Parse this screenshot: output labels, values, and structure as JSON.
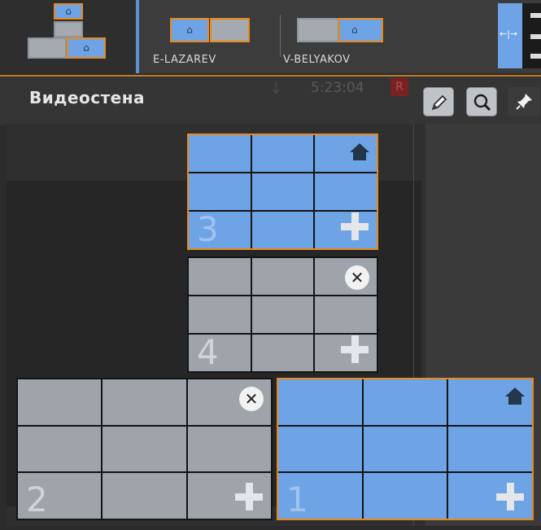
{
  "topbar": {
    "users": [
      {
        "name": "E-LAZAREV"
      },
      {
        "name": "V-BELYAKOV"
      }
    ],
    "arrows_glyph": "←|→",
    "mini_home_glyph": "⌂"
  },
  "header": {
    "title": "Видеостена",
    "ghost_time": "5:23:04",
    "ghost_r": "R",
    "ghost_arrow": "↓"
  },
  "toolbar": {
    "edit_icon": "pencil-icon",
    "search_icon": "search-icon",
    "pin_icon": "pin-icon"
  },
  "monitors": [
    {
      "number": "3",
      "color": "blue",
      "selected": true,
      "corner": "home"
    },
    {
      "number": "4",
      "color": "gray",
      "selected": false,
      "corner": "close",
      "close_glyph": "✕"
    },
    {
      "number": "2",
      "color": "gray",
      "selected": false,
      "corner": "close",
      "close_glyph": "✕"
    },
    {
      "number": "1",
      "color": "blue",
      "selected": true,
      "corner": "home"
    }
  ],
  "colors": {
    "accent_blue": "#6ea4e6",
    "selection_orange": "#e8891c",
    "monitor_gray": "#9fa3aa"
  }
}
